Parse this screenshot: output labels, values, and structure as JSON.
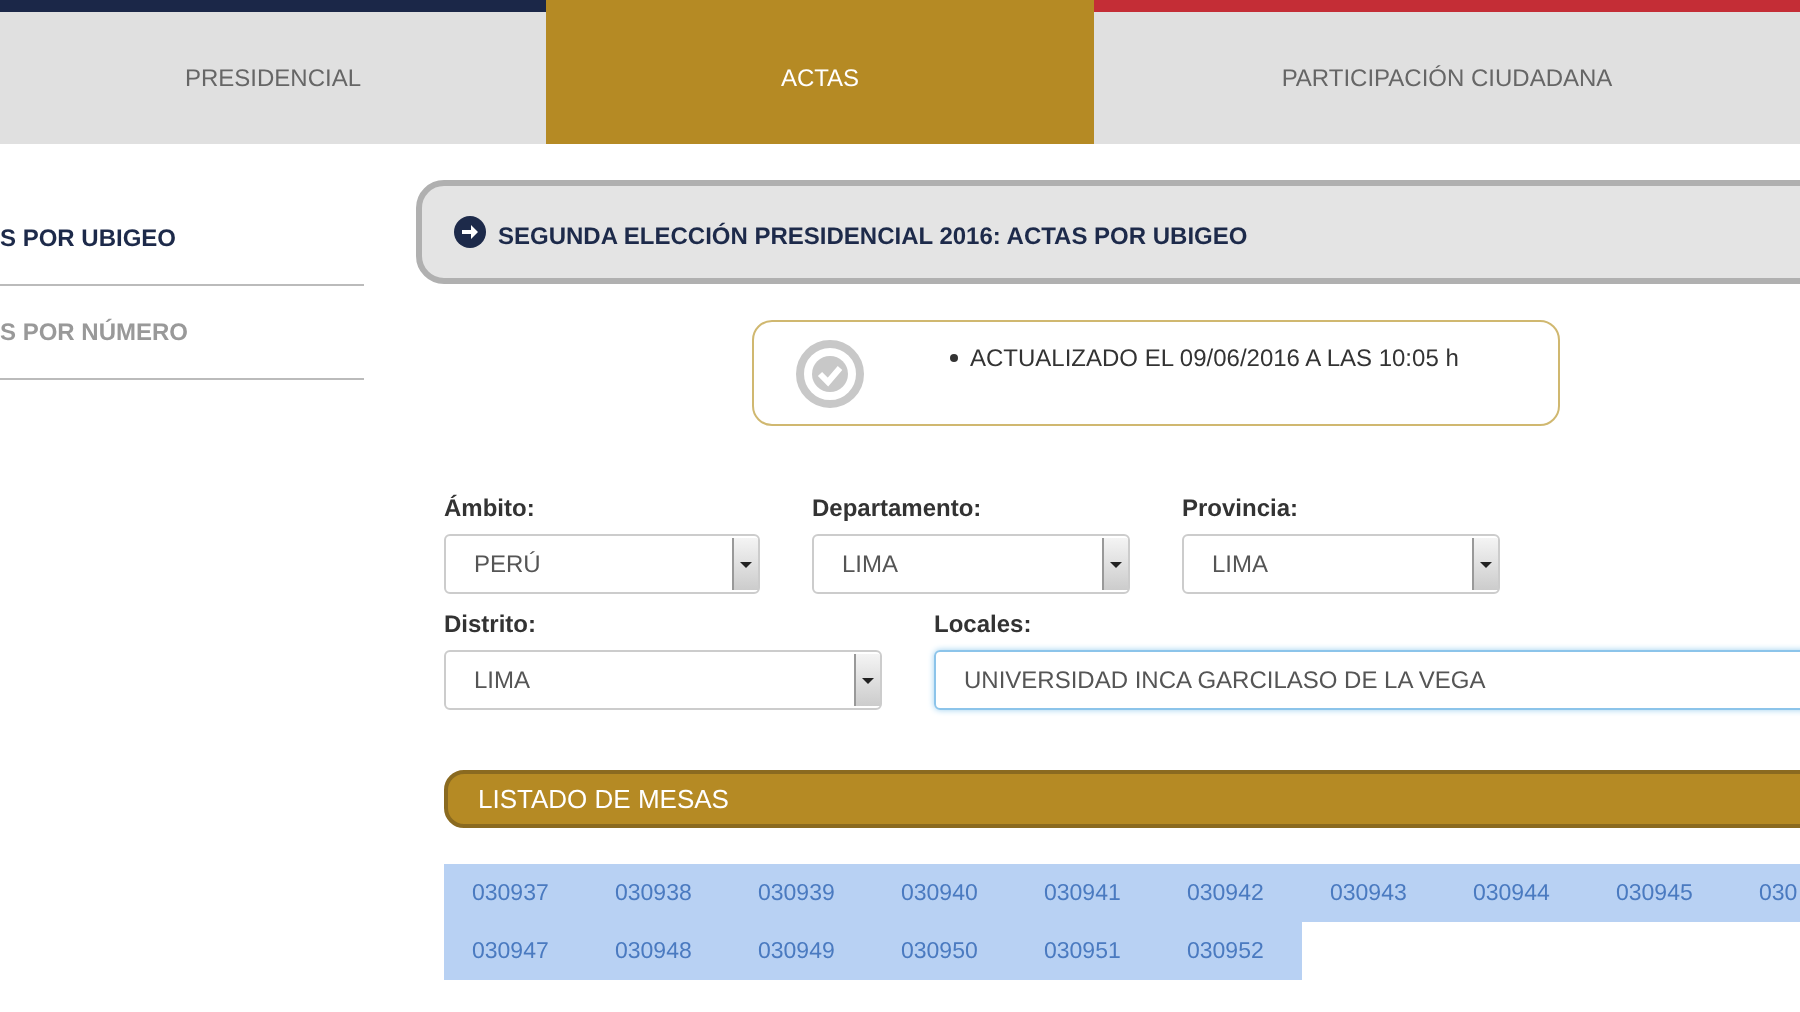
{
  "tabs": [
    {
      "label": "PRESIDENCIAL",
      "selected": false
    },
    {
      "label": "ACTAS",
      "selected": true
    },
    {
      "label": "PARTICIPACIÓN CIUDADANA",
      "selected": false
    }
  ],
  "sidebar": {
    "items": [
      {
        "label": "S POR UBIGEO",
        "selected": true
      },
      {
        "label": "S POR NÚMERO",
        "selected": false
      }
    ]
  },
  "panel_title": "SEGUNDA ELECCIÓN PRESIDENCIAL 2016: ACTAS POR UBIGEO",
  "update_notice": "ACTUALIZADO EL 09/06/2016 A LAS 10:05 h",
  "filters": [
    [
      {
        "label": "Ámbito:",
        "value": "PERÚ",
        "kind": "dropdown"
      },
      {
        "label": "Departamento:",
        "value": "LIMA",
        "kind": "dropdown"
      },
      {
        "label": "Provincia:",
        "value": "LIMA",
        "kind": "dropdown"
      }
    ],
    [
      {
        "label": "Distrito:",
        "value": "LIMA",
        "kind": "dropdown"
      },
      {
        "label": "Locales:",
        "value": "UNIVERSIDAD INCA GARCILASO DE LA VEGA",
        "kind": "field"
      }
    ]
  ],
  "list_title": "LISTADO DE MESAS",
  "mesas": [
    "030937",
    "030938",
    "030939",
    "030940",
    "030941",
    "030942",
    "030943",
    "030944",
    "030945",
    "030",
    "030947",
    "030948",
    "030949",
    "030950",
    "030951",
    "030952"
  ]
}
